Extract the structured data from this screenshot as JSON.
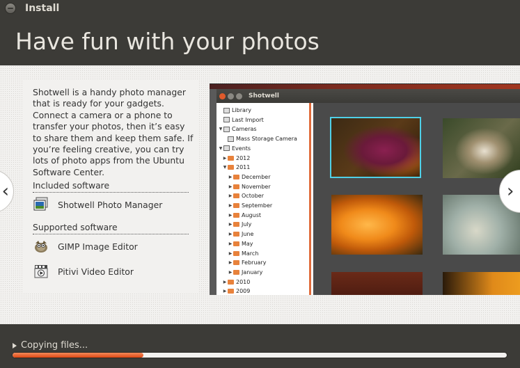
{
  "window": {
    "title": "Install"
  },
  "header": {
    "title": "Have fun with your photos"
  },
  "main": {
    "description": "Shotwell is a handy photo manager that is ready for your gadgets. Connect a camera or a phone to transfer your photos, then it’s easy to share them and keep them safe. If you’re feeling creative, you can try lots of photo apps from the Ubuntu Software Center.",
    "included_title": "Included software",
    "included": [
      {
        "label": "Shotwell Photo Manager",
        "icon": "shotwell-icon"
      }
    ],
    "supported_title": "Supported software",
    "supported": [
      {
        "label": "GIMP Image Editor",
        "icon": "gimp-icon"
      },
      {
        "label": "Pitivi Video Editor",
        "icon": "pitivi-icon"
      }
    ],
    "prev_arrow": "‹",
    "next_arrow": "›"
  },
  "screenshot": {
    "app_title": "Shotwell",
    "tree": [
      {
        "label": "Library",
        "level": 0,
        "kind": "library"
      },
      {
        "label": "Last Import",
        "level": 0,
        "kind": "clock"
      },
      {
        "label": "Cameras",
        "level": 0,
        "kind": "camera",
        "expanded": true
      },
      {
        "label": "Mass Storage Camera",
        "level": 1,
        "kind": "camera"
      },
      {
        "label": "Events",
        "level": 0,
        "kind": "events",
        "expanded": true
      },
      {
        "label": "2012",
        "level": 1,
        "kind": "folder"
      },
      {
        "label": "2011",
        "level": 1,
        "kind": "folder",
        "expanded": true
      },
      {
        "label": "December",
        "level": 2,
        "kind": "folder"
      },
      {
        "label": "November",
        "level": 2,
        "kind": "folder"
      },
      {
        "label": "October",
        "level": 2,
        "kind": "folder"
      },
      {
        "label": "September",
        "level": 2,
        "kind": "folder"
      },
      {
        "label": "August",
        "level": 2,
        "kind": "folder"
      },
      {
        "label": "July",
        "level": 2,
        "kind": "folder"
      },
      {
        "label": "June",
        "level": 2,
        "kind": "folder"
      },
      {
        "label": "May",
        "level": 2,
        "kind": "folder"
      },
      {
        "label": "March",
        "level": 2,
        "kind": "folder"
      },
      {
        "label": "February",
        "level": 2,
        "kind": "folder"
      },
      {
        "label": "January",
        "level": 2,
        "kind": "folder"
      },
      {
        "label": "2010",
        "level": 1,
        "kind": "folder"
      },
      {
        "label": "2009",
        "level": 1,
        "kind": "folder"
      }
    ]
  },
  "footer": {
    "status": "Copying files...",
    "progress": 0.265
  },
  "colors": {
    "accent": "#dd4814",
    "selection": "#4fd0e8",
    "chrome": "#3c3b37"
  }
}
